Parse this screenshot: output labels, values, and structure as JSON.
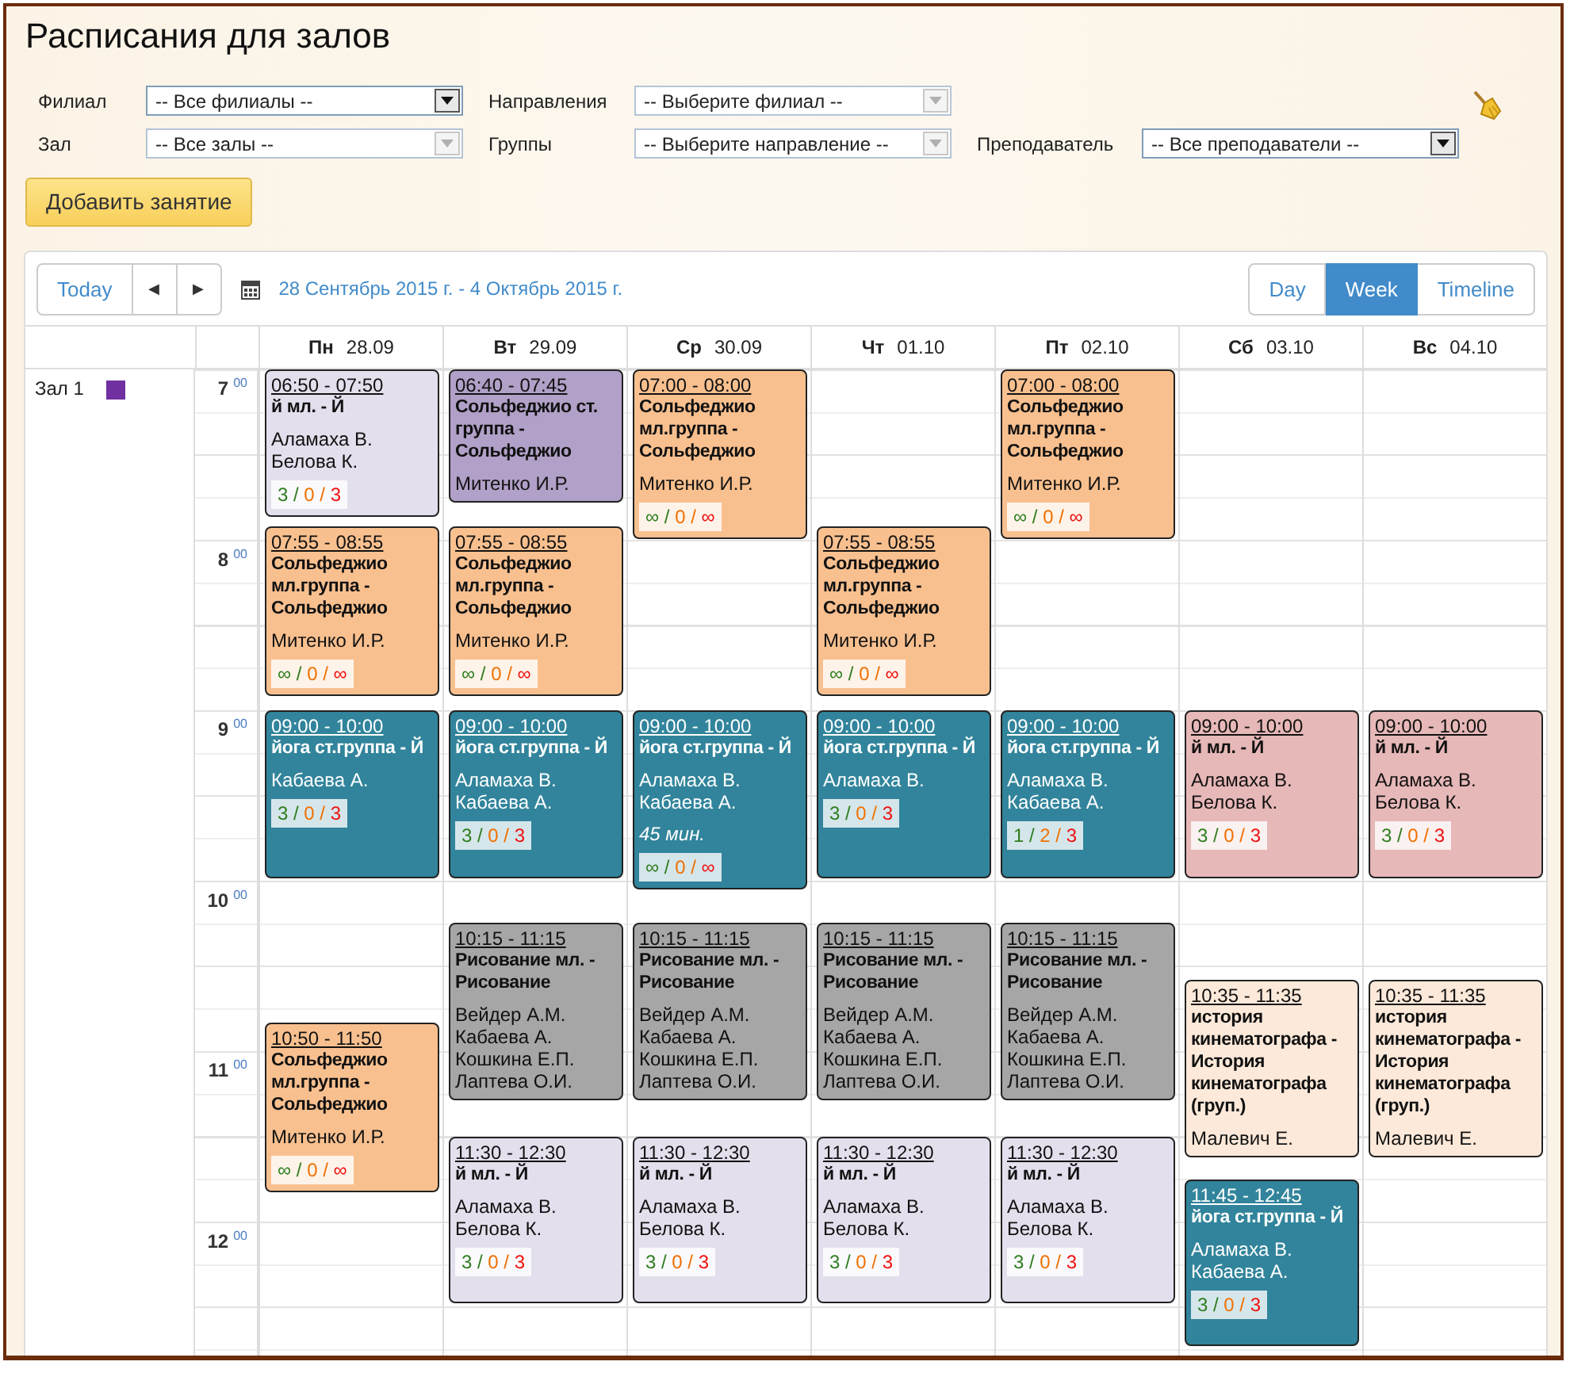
{
  "page": {
    "title": "Расписания для залов"
  },
  "filters": [
    [
      {
        "label": "Филиал",
        "value": "-- Все филиалы --",
        "disabled": false
      },
      {
        "label": "Направления",
        "value": "-- Выберите филиал --",
        "disabled": true
      }
    ],
    [
      {
        "label": "Зал",
        "value": "-- Все залы --",
        "disabled": true
      },
      {
        "label": "Группы",
        "value": "-- Выберите направление --",
        "disabled": true
      },
      {
        "label": "Преподаватель",
        "value": "-- Все преподаватели --",
        "disabled": false
      }
    ]
  ],
  "add_button": "Добавить занятие",
  "toolbar": {
    "today": "Today",
    "prev": "◀",
    "next": "▶",
    "range": "28 Сентябрь 2015 г. - 4 Октябрь 2015 г.",
    "views": [
      {
        "label": "Day",
        "selected": false
      },
      {
        "label": "Week",
        "selected": true
      },
      {
        "label": "Timeline",
        "selected": false
      }
    ]
  },
  "resource": {
    "name": "Зал 1",
    "color": "#7030a0"
  },
  "hours": [
    {
      "hour": "7",
      "minutes": "00"
    },
    {
      "hour": "8",
      "minutes": "00"
    },
    {
      "hour": "9",
      "minutes": "00"
    },
    {
      "hour": "10",
      "minutes": "00"
    },
    {
      "hour": "11",
      "minutes": "00"
    },
    {
      "hour": "12",
      "minutes": "00"
    }
  ],
  "days": [
    {
      "weekday": "Пн",
      "date": "28.09",
      "events": [
        {
          "time": "06:50 - 07:50",
          "title": "й мл. - Й",
          "color": "#e4dfec",
          "people": [
            "Аламаха В.",
            "Белова К."
          ],
          "counts": "3 / 0 / 3"
        },
        {
          "time": "07:55 - 08:55",
          "title": "Сольфеджио мл.группа - Сольфеджио",
          "color": "#f9c08f",
          "people": [
            "Митенко И.Р."
          ],
          "counts": "∞ / 0 / ∞"
        },
        {
          "time": "09:00 - 10:00",
          "title": "йога ст.группа - Й",
          "color": "#31849b",
          "people": [
            "Кабаева А."
          ],
          "counts": "3 / 0 / 3"
        },
        {
          "time": "10:50 - 11:50",
          "title": "Сольфеджио мл.группа - Сольфеджио",
          "color": "#f9c08f",
          "people": [
            "Митенко И.Р."
          ],
          "counts": "∞ / 0 / ∞"
        }
      ]
    },
    {
      "weekday": "Вт",
      "date": "29.09",
      "events": [
        {
          "time": "06:40 - 07:45",
          "title": "Сольфеджио ст. группа - Сольфеджио",
          "color": "#b1a0c7",
          "people": [
            "Митенко И.Р."
          ]
        },
        {
          "time": "07:55 - 08:55",
          "title": "Сольфеджио мл.группа - Сольфеджио",
          "color": "#f9c08f",
          "people": [
            "Митенко И.Р."
          ],
          "counts": "∞ / 0 / ∞"
        },
        {
          "time": "09:00 - 10:00",
          "title": "йога ст.группа - Й",
          "color": "#31849b",
          "people": [
            "Аламаха В.",
            "Кабаева А."
          ],
          "counts": "3 / 0 / 3"
        },
        {
          "time": "10:15 - 11:15",
          "title": "Рисование мл. - Рисование",
          "color": "#a6a6a6",
          "people": [
            "Вейдер А.М.",
            "Кабаева А.",
            "Кошкина Е.П.",
            "Лаптева О.И."
          ]
        },
        {
          "time": "11:30 - 12:30",
          "title": "й мл. - Й",
          "color": "#e4dfec",
          "people": [
            "Аламаха В.",
            "Белова К."
          ],
          "counts": "3 / 0 / 3"
        }
      ]
    },
    {
      "weekday": "Ср",
      "date": "30.09",
      "events": [
        {
          "time": "07:00 - 08:00",
          "title": "Сольфеджио мл.группа - Сольфеджио",
          "color": "#f9c08f",
          "people": [
            "Митенко И.Р."
          ],
          "counts": "∞ / 0 / ∞"
        },
        {
          "time": "09:00 - 10:00",
          "title": "йога ст.группа - Й",
          "color": "#31849b",
          "people": [
            "Аламаха В.",
            "Кабаева А."
          ],
          "note": "45 мин.",
          "counts": "∞ / 0 / ∞"
        },
        {
          "time": "10:15 - 11:15",
          "title": "Рисование мл. - Рисование",
          "color": "#a6a6a6",
          "people": [
            "Вейдер А.М.",
            "Кабаева А.",
            "Кошкина Е.П.",
            "Лаптева О.И."
          ]
        },
        {
          "time": "11:30 - 12:30",
          "title": "й мл. - Й",
          "color": "#e4dfec",
          "people": [
            "Аламаха В.",
            "Белова К."
          ],
          "counts": "3 / 0 / 3"
        }
      ]
    },
    {
      "weekday": "Чт",
      "date": "01.10",
      "events": [
        {
          "time": "07:55 - 08:55",
          "title": "Сольфеджио мл.группа - Сольфеджио",
          "color": "#f9c08f",
          "people": [
            "Митенко И.Р."
          ],
          "counts": "∞ / 0 / ∞"
        },
        {
          "time": "09:00 - 10:00",
          "title": "йога ст.группа - Й",
          "color": "#31849b",
          "people": [
            "Аламаха В."
          ],
          "counts": "3 / 0 / 3"
        },
        {
          "time": "10:15 - 11:15",
          "title": "Рисование мл. - Рисование",
          "color": "#a6a6a6",
          "people": [
            "Вейдер А.М.",
            "Кабаева А.",
            "Кошкина Е.П.",
            "Лаптева О.И."
          ]
        },
        {
          "time": "11:30 - 12:30",
          "title": "й мл. - Й",
          "color": "#e4dfec",
          "people": [
            "Аламаха В.",
            "Белова К."
          ],
          "counts": "3 / 0 / 3"
        }
      ]
    },
    {
      "weekday": "Пт",
      "date": "02.10",
      "events": [
        {
          "time": "07:00 - 08:00",
          "title": "Сольфеджио мл.группа - Сольфеджио",
          "color": "#f9c08f",
          "people": [
            "Митенко И.Р."
          ],
          "counts": "∞ / 0 / ∞"
        },
        {
          "time": "09:00 - 10:00",
          "title": "йога ст.группа - Й",
          "color": "#31849b",
          "people": [
            "Аламаха В.",
            "Кабаева А."
          ],
          "counts": "1 / 2 / 3"
        },
        {
          "time": "10:15 - 11:15",
          "title": "Рисование мл. - Рисование",
          "color": "#a6a6a6",
          "people": [
            "Вейдер А.М.",
            "Кабаева А.",
            "Кошкина Е.П.",
            "Лаптева О.И."
          ]
        },
        {
          "time": "11:30 - 12:30",
          "title": "й мл. - Й",
          "color": "#e4dfec",
          "people": [
            "Аламаха В.",
            "Белова К."
          ],
          "counts": "3 / 0 / 3"
        }
      ]
    },
    {
      "weekday": "Сб",
      "date": "03.10",
      "events": [
        {
          "time": "09:00 - 10:00",
          "title": "й мл. - Й",
          "color": "#e6b8b7",
          "people": [
            "Аламаха В.",
            "Белова К."
          ],
          "counts": "3 / 0 / 3"
        },
        {
          "time": "10:35 - 11:35",
          "title": "история кинематографа - История кинематографа (груп.)",
          "color": "#fde9d9",
          "people": [
            "Малевич Е."
          ]
        },
        {
          "time": "11:45 - 12:45",
          "title": "йога ст.группа - Й",
          "color": "#31849b",
          "people": [
            "Аламаха В.",
            "Кабаева А."
          ],
          "counts": "3 / 0 / 3"
        }
      ]
    },
    {
      "weekday": "Вс",
      "date": "04.10",
      "events": [
        {
          "time": "09:00 - 10:00",
          "title": "й мл. - Й",
          "color": "#e6b8b7",
          "people": [
            "Аламаха В.",
            "Белова К."
          ],
          "counts": "3 / 0 / 3"
        },
        {
          "time": "10:35 - 11:35",
          "title": "история кинематографа - История кинематографа (груп.)",
          "color": "#fde9d9",
          "people": [
            "Малевич Е."
          ]
        }
      ]
    }
  ]
}
